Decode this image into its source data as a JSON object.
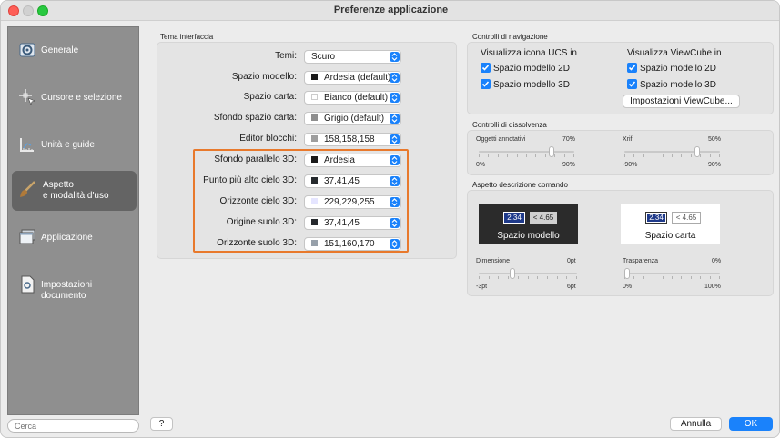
{
  "window": {
    "title": "Preferenze applicazione"
  },
  "sidebar": {
    "items": [
      {
        "label": "Generale",
        "icon": "gear-icon"
      },
      {
        "label": "Cursore e selezione",
        "icon": "crosshair-cursor-icon"
      },
      {
        "label": "Unità e guide",
        "icon": "ruler-icon"
      },
      {
        "label_line1": "Aspetto",
        "label_line2": "e modalità d'uso",
        "icon": "paintbrush-icon",
        "active": true
      },
      {
        "label": "Applicazione",
        "icon": "window-icon"
      },
      {
        "label": "Impostazioni documento",
        "icon": "document-gear-icon"
      }
    ],
    "search_placeholder": "Cerca"
  },
  "theme": {
    "section_title": "Tema interfaccia",
    "rows": [
      {
        "label": "Temi:",
        "value": "Scuro",
        "swatch": null
      },
      {
        "label": "Spazio modello:",
        "value": "Ardesia (default)",
        "swatch": "#1a1a1a"
      },
      {
        "label": "Spazio carta:",
        "value": "Bianco (default)",
        "swatch": "#ffffff"
      },
      {
        "label": "Sfondo spazio carta:",
        "value": "Grigio (default)",
        "swatch": "#8e8e8e"
      },
      {
        "label": "Editor blocchi:",
        "value": "158,158,158",
        "swatch": "#9e9e9e"
      },
      {
        "label": "Sfondo parallelo 3D:",
        "value": "Ardesia",
        "swatch": "#1a1a1a"
      },
      {
        "label": "Punto più alto cielo 3D:",
        "value": "37,41,45",
        "swatch": "#25292d"
      },
      {
        "label": "Orizzonte cielo 3D:",
        "value": "229,229,255",
        "swatch": "#e5e5ff"
      },
      {
        "label": "Origine suolo 3D:",
        "value": "37,41,45",
        "swatch": "#25292d"
      },
      {
        "label": "Orizzonte suolo 3D:",
        "value": "151,160,170",
        "swatch": "#97a0aa"
      }
    ]
  },
  "nav": {
    "section_title": "Controlli di navigazione",
    "ucs_title": "Visualizza icona UCS in",
    "viewcube_title": "Visualizza ViewCube in",
    "ucs_model": "Spazio modello 2D",
    "ucs_model3d": "Spazio modello 3D",
    "vc_model": "Spazio modello 2D",
    "vc_model3d": "Spazio modello 3D",
    "vc_settings": "Impostazioni ViewCube..."
  },
  "fade": {
    "section_title": "Controlli di dissolvenza",
    "annot_label": "Oggetti annotativi",
    "annot_value": "70%",
    "annot_min": "0%",
    "annot_max": "90%",
    "annot_level": 0.78,
    "xref_label": "Xrif",
    "xref_value": "50%",
    "xref_min": "-90%",
    "xref_max": "90%",
    "xref_level": 0.78
  },
  "cmd": {
    "section_title": "Aspetto descrizione comando",
    "dark_value": "2.34",
    "dark_hint": "< 4.65",
    "dark_label": "Spazio modello",
    "light_value": "2.34",
    "light_hint": "< 4.65",
    "light_label": "Spazio carta",
    "size_label": "Dimensione",
    "size_value": "0pt",
    "size_min": "-3pt",
    "size_max": "6pt",
    "size_level": 0.33,
    "transp_label": "Trasparenza",
    "transp_value": "0%",
    "transp_min": "0%",
    "transp_max": "100%",
    "transp_level": 0.0
  },
  "footer": {
    "help": "?",
    "cancel": "Annulla",
    "ok": "OK"
  },
  "colors": {
    "accent": "#1a82fb",
    "highlight": "#e8792c",
    "sidebar": "#8f8f8f",
    "sidebar_active": "#646464"
  }
}
